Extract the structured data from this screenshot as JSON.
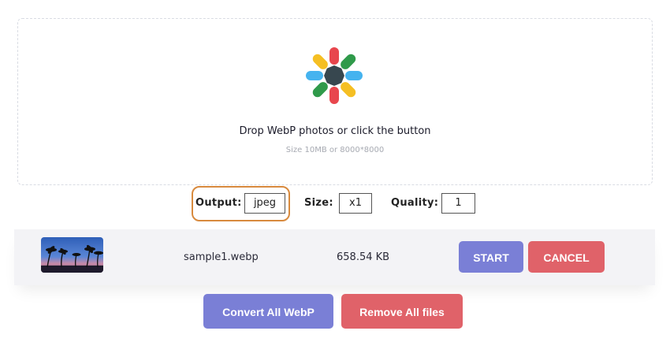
{
  "dropzone": {
    "title": "Drop WebP photos or click the button",
    "subtitle": "Size 10MB or 8000*8000",
    "logo_icon": "webp-flower-logo-icon"
  },
  "options": {
    "output_label": "Output:",
    "output_value": "jpeg",
    "size_label": "Size:",
    "size_value": "x1",
    "quality_label": "Quality:",
    "quality_value": "1"
  },
  "file": {
    "name": "sample1.webp",
    "size": "658.54 KB",
    "thumbnail": "palm-trees-sunset-thumbnail",
    "start_label": "START",
    "cancel_label": "CANCEL"
  },
  "actions": {
    "convert_all_label": "Convert All WebP",
    "remove_all_label": "Remove All files"
  },
  "colors": {
    "primary": "#7a7fd6",
    "danger": "#e06269",
    "highlight": "#d88a3e"
  }
}
